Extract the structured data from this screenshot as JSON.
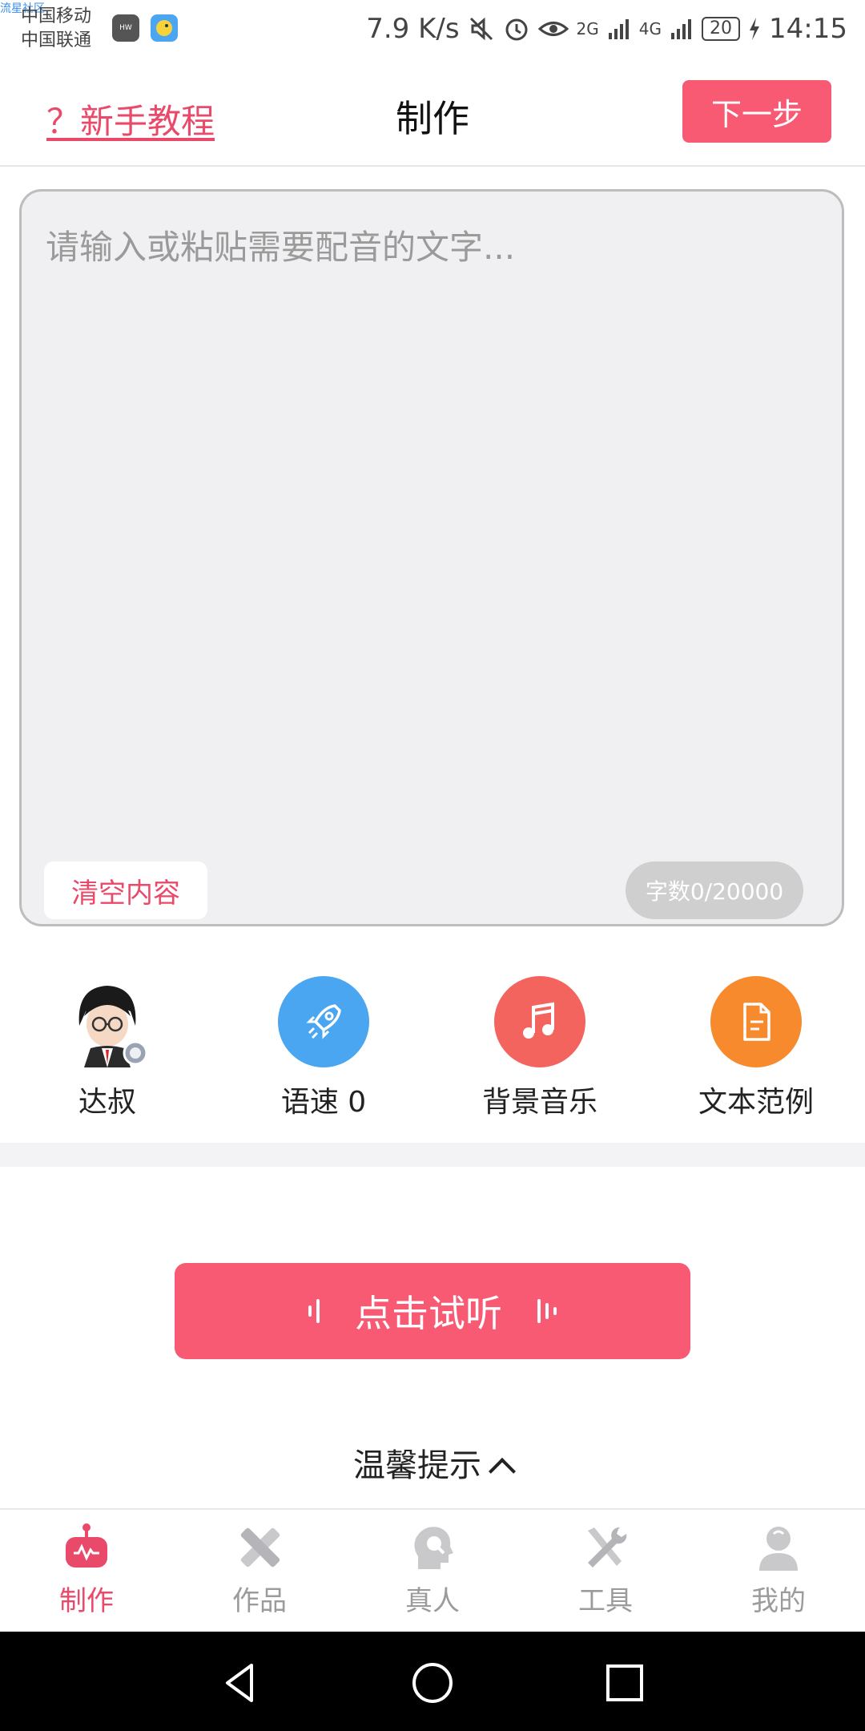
{
  "status_bar": {
    "watermark": "流星社区",
    "carrier_1": "中国移动",
    "carrier_2": "中国联通",
    "net_speed": "7.9 K/s",
    "signal_1": "2G",
    "signal_2": "4G",
    "battery": "20",
    "time": "14:15",
    "app_icons": [
      "huawei-app-icon",
      "bird-app-icon"
    ]
  },
  "header": {
    "tutorial_link": "？新手教程",
    "title": "制作",
    "next_button": "下一步"
  },
  "editor": {
    "placeholder": "请输入或粘贴需要配音的文字...",
    "value": "",
    "clear_button": "清空内容",
    "char_count": "字数0/20000"
  },
  "tools": [
    {
      "label": "达叔",
      "icon": "voice-avatar"
    },
    {
      "label": "语速 0",
      "icon": "rocket-icon",
      "color": "#4aa6f0"
    },
    {
      "label": "背景音乐",
      "icon": "music-note-icon",
      "color": "#f4645f"
    },
    {
      "label": "文本范例",
      "icon": "document-icon",
      "color": "#f78a2c"
    }
  ],
  "listen_button": "点击试听",
  "tips_label": "温馨提示",
  "tab_bar": [
    {
      "label": "制作",
      "icon": "robot-icon",
      "active": true
    },
    {
      "label": "作品",
      "icon": "pencil-ruler-icon",
      "active": false
    },
    {
      "label": "真人",
      "icon": "head-mic-icon",
      "active": false
    },
    {
      "label": "工具",
      "icon": "tools-icon",
      "active": false
    },
    {
      "label": "我的",
      "icon": "person-icon",
      "active": false
    }
  ],
  "colors": {
    "accent": "#f75a72",
    "accent_text": "#e94a6a",
    "tab_inactive": "#9b9b9b",
    "editor_bg": "#f0f0f2"
  },
  "system_nav": [
    "back-icon",
    "home-icon",
    "recents-icon"
  ]
}
